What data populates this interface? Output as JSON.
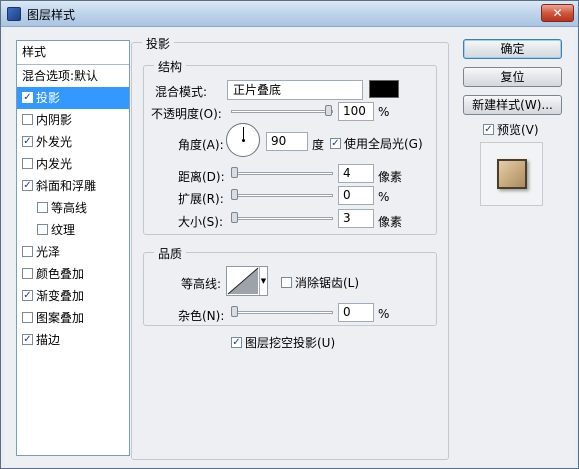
{
  "window": {
    "title": "图层样式",
    "close_glyph": "✕"
  },
  "styles_panel": {
    "header": "样式",
    "items": [
      {
        "label": "混合选项:默认",
        "checkbox": false,
        "checked": false,
        "indent": false,
        "selected": false
      },
      {
        "label": "投影",
        "checkbox": true,
        "checked": true,
        "indent": false,
        "selected": true
      },
      {
        "label": "内阴影",
        "checkbox": true,
        "checked": false,
        "indent": false,
        "selected": false
      },
      {
        "label": "外发光",
        "checkbox": true,
        "checked": true,
        "indent": false,
        "selected": false
      },
      {
        "label": "内发光",
        "checkbox": true,
        "checked": false,
        "indent": false,
        "selected": false
      },
      {
        "label": "斜面和浮雕",
        "checkbox": true,
        "checked": true,
        "indent": false,
        "selected": false
      },
      {
        "label": "等高线",
        "checkbox": true,
        "checked": false,
        "indent": true,
        "selected": false
      },
      {
        "label": "纹理",
        "checkbox": true,
        "checked": false,
        "indent": true,
        "selected": false
      },
      {
        "label": "光泽",
        "checkbox": true,
        "checked": false,
        "indent": false,
        "selected": false
      },
      {
        "label": "颜色叠加",
        "checkbox": true,
        "checked": false,
        "indent": false,
        "selected": false
      },
      {
        "label": "渐变叠加",
        "checkbox": true,
        "checked": true,
        "indent": false,
        "selected": false
      },
      {
        "label": "图案叠加",
        "checkbox": true,
        "checked": false,
        "indent": false,
        "selected": false
      },
      {
        "label": "描边",
        "checkbox": true,
        "checked": true,
        "indent": false,
        "selected": false
      }
    ]
  },
  "drop_shadow": {
    "section_title": "投影",
    "structure": {
      "title": "结构",
      "blend_mode_label": "混合模式:",
      "blend_mode_value": "正片叠底",
      "blend_color": "#000000",
      "opacity_label": "不透明度(O):",
      "opacity_value": "100",
      "opacity_unit": "%",
      "opacity_level": 100,
      "angle_label": "角度(A):",
      "angle_value": "90",
      "angle_unit": "度",
      "global_light_label": "使用全局光(G)",
      "global_light_checked": true,
      "distance_label": "距离(D):",
      "distance_value": "4",
      "distance_unit": "像素",
      "spread_label": "扩展(R):",
      "spread_value": "0",
      "spread_unit": "%",
      "size_label": "大小(S):",
      "size_value": "3",
      "size_unit": "像素"
    },
    "quality": {
      "title": "品质",
      "contour_label": "等高线:",
      "antialias_label": "消除锯齿(L)",
      "antialias_checked": false,
      "noise_label": "杂色(N):",
      "noise_value": "0",
      "noise_unit": "%"
    },
    "knockout_label": "图层挖空投影(U)",
    "knockout_checked": true
  },
  "buttons": {
    "ok": "确定",
    "reset": "复位",
    "new_style": "新建样式(W)...",
    "preview_label": "预览(V)",
    "preview_checked": true
  },
  "colors": {
    "selection": "#3399ff",
    "preview_swatch": "#c9ad80"
  }
}
